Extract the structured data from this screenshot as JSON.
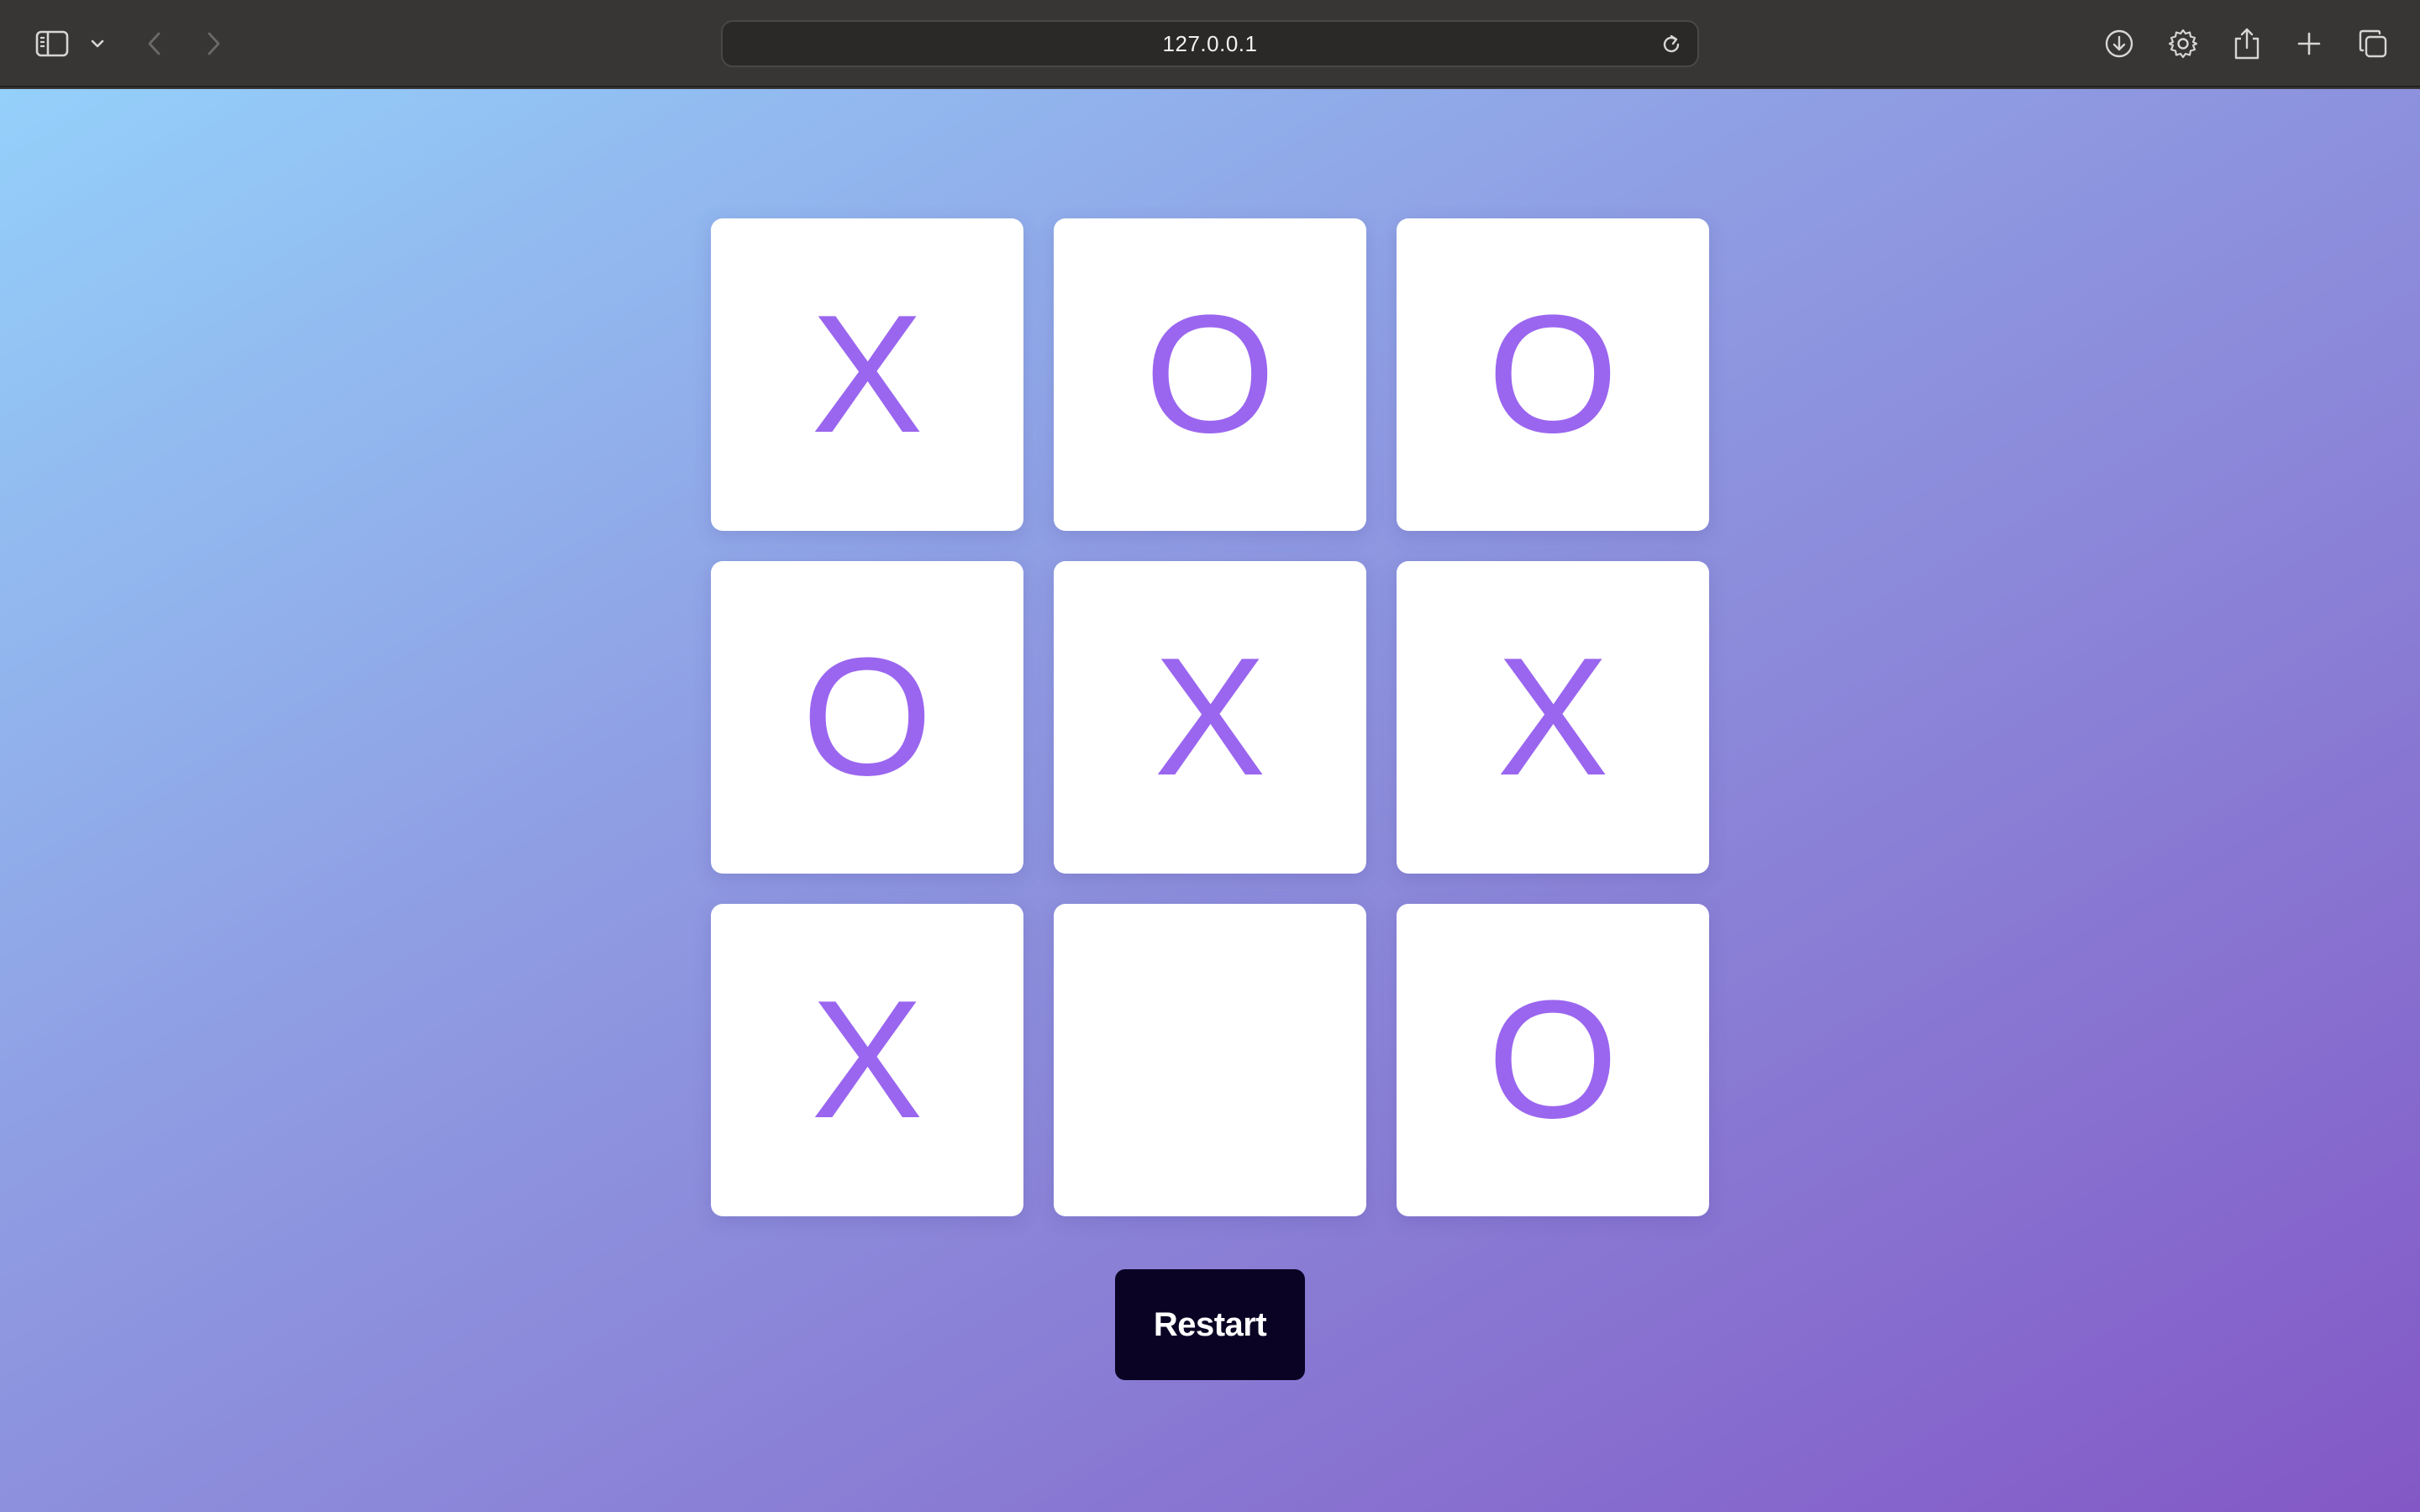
{
  "browser": {
    "url": "127.0.0.1",
    "icons": {
      "sidebar": "sidebar-icon",
      "sidebar_menu": "chevron-down-icon",
      "back": "chevron-left-icon",
      "forward": "chevron-right-icon",
      "reload": "reload-icon",
      "downloads": "download-icon",
      "settings": "gear-icon",
      "share": "share-icon",
      "new_tab": "plus-icon",
      "tab_overview": "tabs-icon"
    }
  },
  "game": {
    "board": [
      "X",
      "O",
      "O",
      "O",
      "X",
      "X",
      "X",
      "",
      "O"
    ],
    "mark_color": "#9a66ef",
    "restart_label": "Restart"
  },
  "colors": {
    "gradient_start": "#94d0fa",
    "gradient_end": "#8358c6",
    "button_bg": "#0b0324"
  }
}
